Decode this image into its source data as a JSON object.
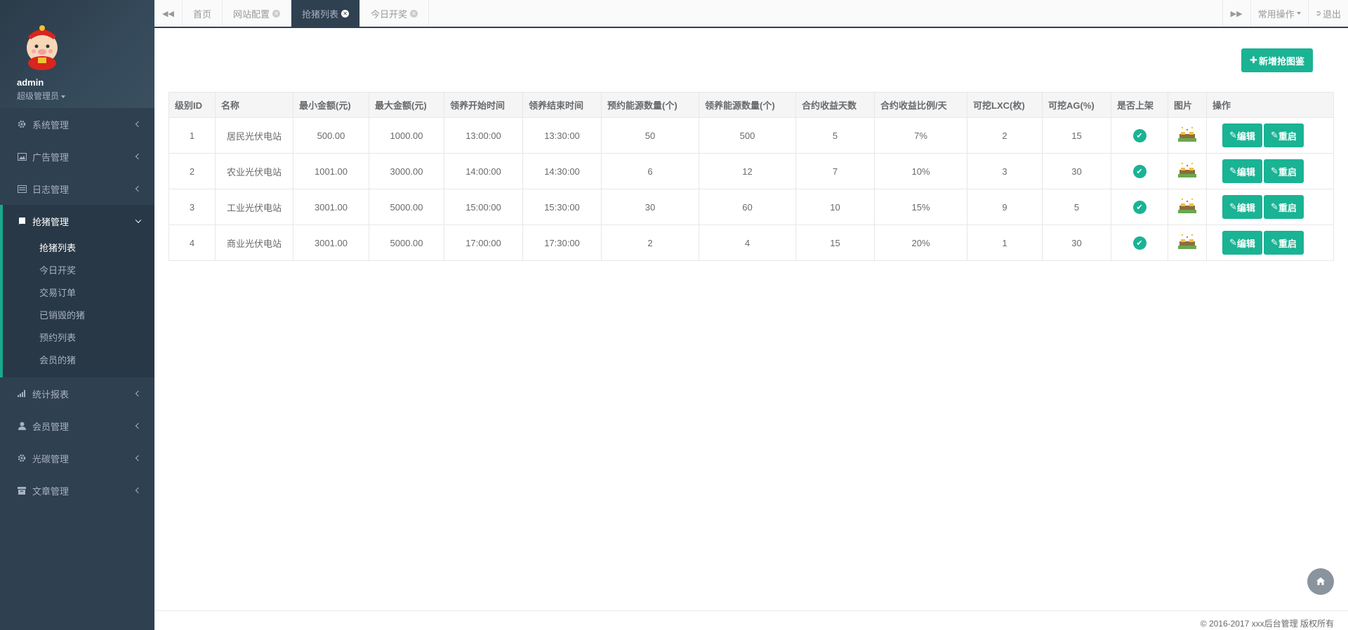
{
  "profile": {
    "name": "admin",
    "role": "超级管理员"
  },
  "sidebar": {
    "items_top": [
      {
        "label": "系统管理",
        "icon": "gear-icon"
      },
      {
        "label": "广告管理",
        "icon": "image-icon"
      },
      {
        "label": "日志管理",
        "icon": "list-icon"
      }
    ],
    "active_group": {
      "label": "抢猪管理",
      "icon": "book-icon",
      "children": [
        "抢猪列表",
        "今日开奖",
        "交易订单",
        "已销毁的猪",
        "预约列表",
        "会员的猪"
      ]
    },
    "items_bottom": [
      {
        "label": "统计报表",
        "icon": "bar-chart-icon"
      },
      {
        "label": "会员管理",
        "icon": "user-icon"
      },
      {
        "label": "光碳管理",
        "icon": "gear-icon"
      },
      {
        "label": "文章管理",
        "icon": "archive-icon"
      }
    ]
  },
  "tabs": [
    {
      "label": "首页"
    },
    {
      "label": "网站配置"
    },
    {
      "label": "抢猪列表"
    },
    {
      "label": "今日开奖"
    }
  ],
  "topbar": {
    "common_ops": "常用操作",
    "logout": "退出"
  },
  "main": {
    "add_button": "新增抢图鉴"
  },
  "table": {
    "headers": [
      "级别ID",
      "名称",
      "最小金额(元)",
      "最大金额(元)",
      "领养开始时间",
      "领养结束时间",
      "预约能源数量(个)",
      "领养能源数量(个)",
      "合约收益天数",
      "合约收益比例/天",
      "可挖LXC(枚)",
      "可挖AG(%)",
      "是否上架",
      "图片",
      "操作"
    ],
    "edit_label": "编辑",
    "restart_label": "重启",
    "rows": [
      [
        "1",
        "居民光伏电站",
        "500.00",
        "1000.00",
        "13:00:00",
        "13:30:00",
        "50",
        "500",
        "5",
        "7%",
        "2",
        "15"
      ],
      [
        "2",
        "农业光伏电站",
        "1001.00",
        "3000.00",
        "14:00:00",
        "14:30:00",
        "6",
        "12",
        "7",
        "10%",
        "3",
        "30"
      ],
      [
        "3",
        "工业光伏电站",
        "3001.00",
        "5000.00",
        "15:00:00",
        "15:30:00",
        "30",
        "60",
        "10",
        "15%",
        "9",
        "5"
      ],
      [
        "4",
        "商业光伏电站",
        "3001.00",
        "5000.00",
        "17:00:00",
        "17:30:00",
        "2",
        "4",
        "15",
        "20%",
        "1",
        "30"
      ]
    ]
  },
  "footer": {
    "text": "© 2016-2017 xxx后台管理 版权所有"
  },
  "colors": {
    "sidebar": "#2f4050",
    "accent": "#1ab394"
  }
}
